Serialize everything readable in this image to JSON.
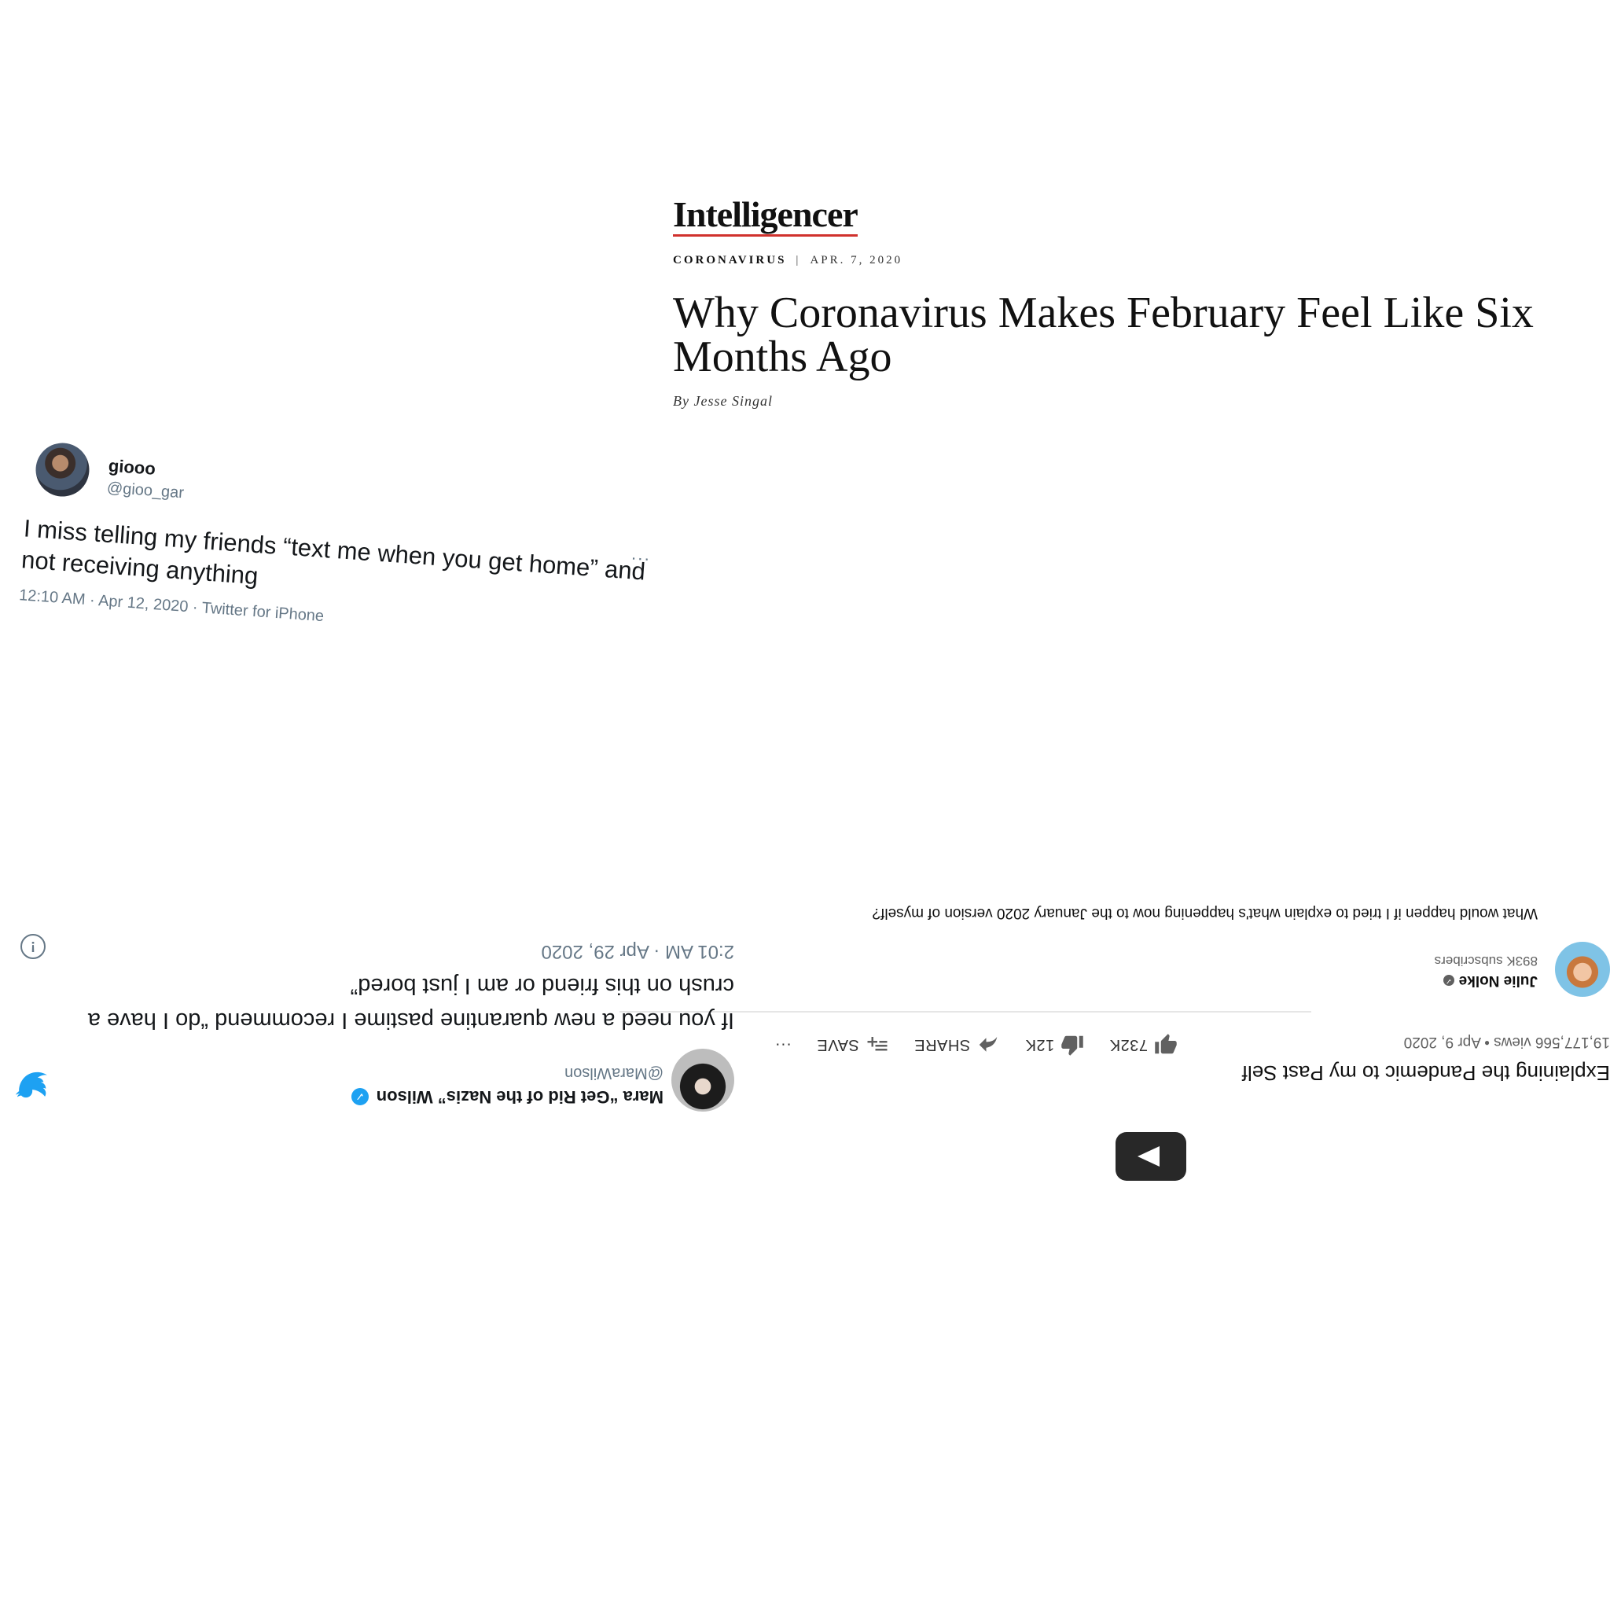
{
  "article": {
    "masthead": "Intelligencer",
    "section": "CORONAVIRUS",
    "separator": "|",
    "date": "APR. 7, 2020",
    "headline": "Why Coronavirus Makes February Feel Like Six Months Ago",
    "byline": "By Jesse Singal"
  },
  "tweet1": {
    "name": "giooo",
    "handle": "@gioo_gar",
    "more": "···",
    "text": "I miss telling my friends “text me when you get home” and not receiving anything",
    "timestamp": "12:10 AM · Apr 12, 2020 · Twitter for iPhone"
  },
  "youtube": {
    "title": "Explaining the Pandemic to my Past Self",
    "views_date": "19,177,566 views • Apr 9, 2020",
    "dislikes": "732K",
    "likes": "12K",
    "share_label": "SHARE",
    "save_label": "SAVE",
    "more": "···",
    "channel_name": "Julie Nolke",
    "subscribers": "893K subscribers",
    "description": "What would happen if I tried to explain what's happening now to the January 2020 version of myself?"
  },
  "tweet2": {
    "name": "Mara “Get Rid of the Nazis” Wilson",
    "handle": "@MaraWilson",
    "text": "If you need a new quarantine pastime I recommend “do I have a crush on this friend or am I just bored”",
    "timestamp": "2:01 AM · Apr 29, 2020",
    "info_glyph": "!"
  },
  "colors": {
    "twitter_blue": "#1da1f2",
    "masthead_underline": "#d0312d",
    "secondary_text": "#657786"
  }
}
